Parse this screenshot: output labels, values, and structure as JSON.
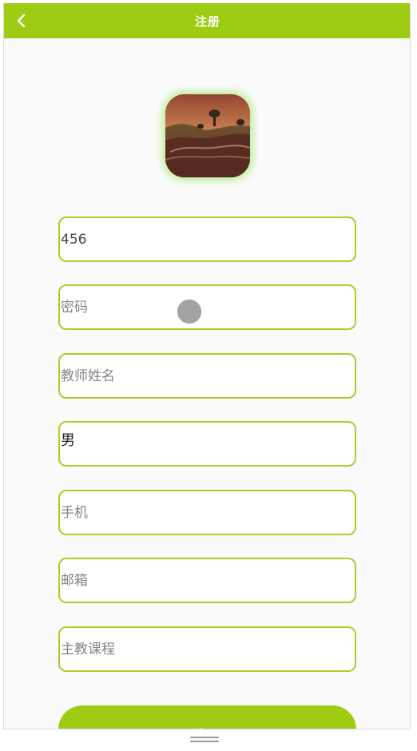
{
  "header": {
    "title": "注册"
  },
  "form": {
    "username": {
      "value": "456",
      "placeholder": ""
    },
    "password": {
      "value": "",
      "placeholder": "密码"
    },
    "teacher_name": {
      "value": "",
      "placeholder": "教师姓名"
    },
    "gender": {
      "value": "男"
    },
    "phone": {
      "value": "",
      "placeholder": "手机"
    },
    "email": {
      "value": "",
      "placeholder": "邮箱"
    },
    "main_course": {
      "value": "",
      "placeholder": "主教课程"
    },
    "submit_label": "注册"
  },
  "colors": {
    "accent": "#9dcc12",
    "field_border": "#a8cf2a",
    "background": "#fafafa",
    "touch_indicator": "#9c9c9c"
  },
  "icons": {
    "back": "chevron-left-icon",
    "home": "home-indicator-icon"
  }
}
